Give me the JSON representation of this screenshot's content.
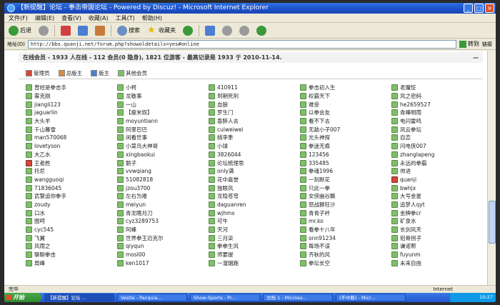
{
  "window": {
    "title": "【新提醒】论坛 - 拳击帝国论坛 - Powered by Discuz! - Microsoft Internet Explorer"
  },
  "menu": [
    "文件(F)",
    "编辑(E)",
    "查看(V)",
    "收藏(A)",
    "工具(T)",
    "帮助(H)"
  ],
  "toolbar": {
    "back": "后退",
    "search": "搜索",
    "favorites": "收藏夹"
  },
  "address": {
    "label": "地址(D)",
    "url": "http://bbs.quanji.net/forum.php?showoldetails=yes#online",
    "go": "转到",
    "links": "链接"
  },
  "online": {
    "header": "在线会员 - 1933 人在线 - 112 会员(0 隐身), 1821 位游客 - 最高记录是 1933 于 2010-11-14.",
    "dash": "—"
  },
  "legend": [
    {
      "label": "管理员",
      "color": "#d04a3a"
    },
    {
      "label": "总版主",
      "color": "#d98a3a"
    },
    {
      "label": "版主",
      "color": "#4a7fd1"
    },
    {
      "label": "其他会员",
      "color": "#7fbf6a"
    }
  ],
  "members": [
    [
      {
        "name": "曾经是拳击手",
        "admin": false
      },
      {
        "name": "雾克刚",
        "admin": false
      },
      {
        "name": "jiangli123",
        "admin": false
      },
      {
        "name": "jaguarlin",
        "admin": false
      },
      {
        "name": "大头羊",
        "admin": false
      },
      {
        "name": "千山暮雪",
        "admin": false
      },
      {
        "name": "man570068",
        "admin": false
      },
      {
        "name": "lovetyson",
        "admin": false
      },
      {
        "name": "大乙水",
        "admin": false
      },
      {
        "name": "王者胜",
        "admin": true
      },
      {
        "name": "托尼",
        "admin": false
      },
      {
        "name": "wangguoqi",
        "admin": false
      },
      {
        "name": "71836045",
        "admin": false
      },
      {
        "name": "武警追你拳手",
        "admin": false
      },
      {
        "name": "zoudy",
        "admin": false
      },
      {
        "name": "口水",
        "admin": false
      },
      {
        "name": "图呵",
        "admin": false
      },
      {
        "name": "cyc545",
        "admin": false
      },
      {
        "name": "飞翼",
        "admin": false
      },
      {
        "name": "风雨之",
        "admin": false
      },
      {
        "name": "聊聊拳击",
        "admin": false
      },
      {
        "name": "周峰",
        "admin": false
      }
    ],
    [
      {
        "name": "小柯",
        "admin": false
      },
      {
        "name": "龙敬事",
        "admin": false
      },
      {
        "name": "一山",
        "admin": false
      },
      {
        "name": "【瘦米奴】",
        "admin": false
      },
      {
        "name": "moyuntiann",
        "admin": false
      },
      {
        "name": "阿里巴巴",
        "admin": false
      },
      {
        "name": "闲看世事",
        "admin": false
      },
      {
        "name": "小菜鸟大神哥",
        "admin": false
      },
      {
        "name": "xingbaokui",
        "admin": false
      },
      {
        "name": "鹅子",
        "admin": false
      },
      {
        "name": "vvwqiang",
        "admin": false
      },
      {
        "name": "51082818",
        "admin": false
      },
      {
        "name": "jzou3700",
        "admin": false
      },
      {
        "name": "左右为难",
        "admin": false
      },
      {
        "name": "meiyun",
        "admin": false
      },
      {
        "name": "青龙瞎月刀",
        "admin": false
      },
      {
        "name": "cyz3289753",
        "admin": false
      },
      {
        "name": "阿峰",
        "admin": false
      },
      {
        "name": "世界拳王迈克尔",
        "admin": false
      },
      {
        "name": "qiyqun",
        "admin": false
      },
      {
        "name": "mosl00",
        "admin": false
      },
      {
        "name": "ken1017",
        "admin": false
      }
    ],
    [
      {
        "name": "410911",
        "admin": false
      },
      {
        "name": "到期死刑",
        "admin": false
      },
      {
        "name": "血狼",
        "admin": false
      },
      {
        "name": "罗生门",
        "admin": false
      },
      {
        "name": "香醉人去",
        "admin": false
      },
      {
        "name": "cuiweiwei",
        "admin": false
      },
      {
        "name": "桃李季",
        "admin": false
      },
      {
        "name": "小球",
        "admin": false
      },
      {
        "name": "3826044",
        "admin": false
      },
      {
        "name": "论坛梳理思",
        "admin": false
      },
      {
        "name": "only满",
        "admin": false
      },
      {
        "name": "花中嘉誉",
        "admin": false
      },
      {
        "name": "独眼风",
        "admin": false
      },
      {
        "name": "龙隐苍穹",
        "admin": false
      },
      {
        "name": "daguanren",
        "admin": false
      },
      {
        "name": "wjhmx",
        "admin": false
      },
      {
        "name": "可牛",
        "admin": false
      },
      {
        "name": "天河",
        "admin": false
      },
      {
        "name": "三月柒",
        "admin": false
      },
      {
        "name": "拳拳生风",
        "admin": false
      },
      {
        "name": "师要提",
        "admin": false
      },
      {
        "name": "一溜烟跑",
        "admin": false
      }
    ],
    [
      {
        "name": "拳击初入生",
        "admin": false
      },
      {
        "name": "权霸天下",
        "admin": false
      },
      {
        "name": "难受",
        "admin": false
      },
      {
        "name": "以拳会友",
        "admin": false
      },
      {
        "name": "看不下去",
        "admin": false
      },
      {
        "name": "无敌小子007",
        "admin": false
      },
      {
        "name": "光头神探",
        "admin": false
      },
      {
        "name": "拳迷无痕",
        "admin": false
      },
      {
        "name": "123456",
        "admin": false
      },
      {
        "name": "335485",
        "admin": false
      },
      {
        "name": "拳魂1996",
        "admin": false
      },
      {
        "name": "一刻默花",
        "admin": false
      },
      {
        "name": "只此一拳",
        "admin": false
      },
      {
        "name": "女侠幽谷飘",
        "admin": false
      },
      {
        "name": "怒战狮狂沙",
        "admin": false
      },
      {
        "name": "青青子衿",
        "admin": false
      },
      {
        "name": "mr.ko",
        "admin": false
      },
      {
        "name": "看拳十八年",
        "admin": false
      },
      {
        "name": "onn91234",
        "admin": false
      },
      {
        "name": "每场不误",
        "admin": false
      },
      {
        "name": "齐秋的风",
        "admin": false
      },
      {
        "name": "拳坛长空",
        "admin": false
      }
    ],
    [
      {
        "name": "老魔怔",
        "admin": false
      },
      {
        "name": "风之密码",
        "admin": false
      },
      {
        "name": "he2659527",
        "admin": false
      },
      {
        "name": "青峰明雨",
        "admin": false
      },
      {
        "name": "电闪雷鸣",
        "admin": false
      },
      {
        "name": "风云拳坛",
        "admin": false
      },
      {
        "name": "自恋",
        "admin": false
      },
      {
        "name": "闪电侠007",
        "admin": false
      },
      {
        "name": "zhanglapeng",
        "admin": false
      },
      {
        "name": "永远的拳霸",
        "admin": false
      },
      {
        "name": "帅进",
        "admin": false
      },
      {
        "name": "quanji",
        "admin": true
      },
      {
        "name": "bwhjx",
        "admin": false
      },
      {
        "name": "大号金星",
        "admin": false
      },
      {
        "name": "追梦人qyt",
        "admin": false
      },
      {
        "name": "金牌拳cr",
        "admin": false
      },
      {
        "name": "矿泉水",
        "admin": false
      },
      {
        "name": "长剑风天",
        "admin": false
      },
      {
        "name": "铝骨拐子",
        "admin": false
      },
      {
        "name": "谦诺帮",
        "admin": false
      },
      {
        "name": "fuyunm",
        "admin": false
      },
      {
        "name": "未来自由",
        "admin": false
      }
    ]
  ],
  "status": {
    "left": "完毕",
    "zone": "Internet"
  },
  "taskbar": {
    "start": "开始",
    "tasks": [
      "【新提醒】论坛 ...",
      "Vestle - Pacquia...",
      "Show-Sports - Pr...",
      "文档 1 - Microso...",
      "(不中断) - Micr..."
    ],
    "clock": "10:27"
  }
}
